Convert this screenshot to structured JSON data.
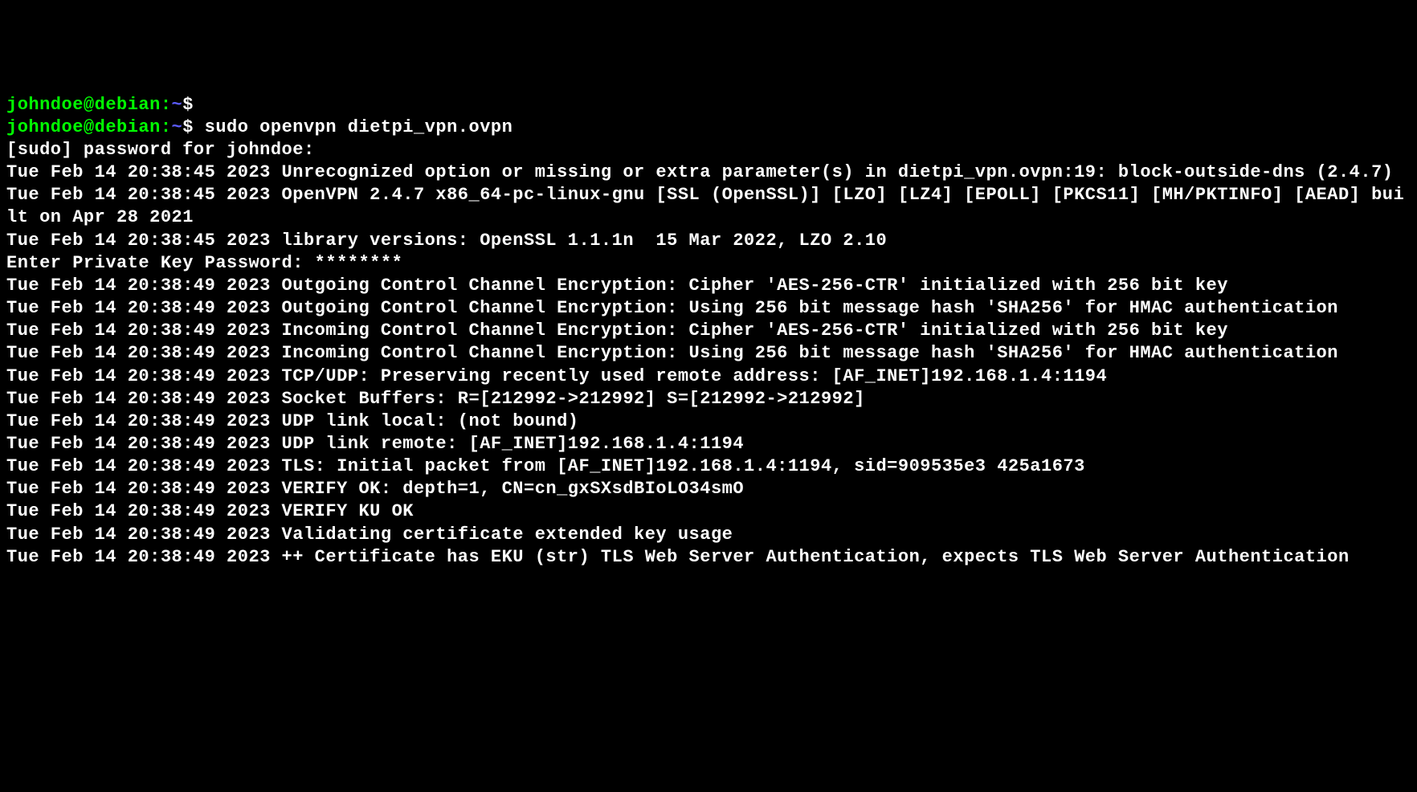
{
  "prompt": {
    "user_host": "johndoe@debian",
    "separator": ":",
    "cwd": "~",
    "symbol": "$"
  },
  "lines": [
    {
      "type": "prompt",
      "cmd": ""
    },
    {
      "type": "prompt",
      "cmd": "sudo openvpn dietpi_vpn.ovpn"
    },
    {
      "type": "output",
      "text": "[sudo] password for johndoe:"
    },
    {
      "type": "output",
      "text": "Tue Feb 14 20:38:45 2023 Unrecognized option or missing or extra parameter(s) in dietpi_vpn.ovpn:19: block-outside-dns (2.4.7)"
    },
    {
      "type": "output",
      "text": "Tue Feb 14 20:38:45 2023 OpenVPN 2.4.7 x86_64-pc-linux-gnu [SSL (OpenSSL)] [LZO] [LZ4] [EPOLL] [PKCS11] [MH/PKTINFO] [AEAD] built on Apr 28 2021"
    },
    {
      "type": "output",
      "text": "Tue Feb 14 20:38:45 2023 library versions: OpenSSL 1.1.1n  15 Mar 2022, LZO 2.10"
    },
    {
      "type": "output",
      "text": "Enter Private Key Password: ********"
    },
    {
      "type": "output",
      "text": "Tue Feb 14 20:38:49 2023 Outgoing Control Channel Encryption: Cipher 'AES-256-CTR' initialized with 256 bit key"
    },
    {
      "type": "output",
      "text": "Tue Feb 14 20:38:49 2023 Outgoing Control Channel Encryption: Using 256 bit message hash 'SHA256' for HMAC authentication"
    },
    {
      "type": "output",
      "text": "Tue Feb 14 20:38:49 2023 Incoming Control Channel Encryption: Cipher 'AES-256-CTR' initialized with 256 bit key"
    },
    {
      "type": "output",
      "text": "Tue Feb 14 20:38:49 2023 Incoming Control Channel Encryption: Using 256 bit message hash 'SHA256' for HMAC authentication"
    },
    {
      "type": "output",
      "text": "Tue Feb 14 20:38:49 2023 TCP/UDP: Preserving recently used remote address: [AF_INET]192.168.1.4:1194"
    },
    {
      "type": "output",
      "text": "Tue Feb 14 20:38:49 2023 Socket Buffers: R=[212992->212992] S=[212992->212992]"
    },
    {
      "type": "output",
      "text": "Tue Feb 14 20:38:49 2023 UDP link local: (not bound)"
    },
    {
      "type": "output",
      "text": "Tue Feb 14 20:38:49 2023 UDP link remote: [AF_INET]192.168.1.4:1194"
    },
    {
      "type": "output",
      "text": "Tue Feb 14 20:38:49 2023 TLS: Initial packet from [AF_INET]192.168.1.4:1194, sid=909535e3 425a1673"
    },
    {
      "type": "output",
      "text": "Tue Feb 14 20:38:49 2023 VERIFY OK: depth=1, CN=cn_gxSXsdBIoLO34smO"
    },
    {
      "type": "output",
      "text": "Tue Feb 14 20:38:49 2023 VERIFY KU OK"
    },
    {
      "type": "output",
      "text": "Tue Feb 14 20:38:49 2023 Validating certificate extended key usage"
    },
    {
      "type": "output",
      "text": "Tue Feb 14 20:38:49 2023 ++ Certificate has EKU (str) TLS Web Server Authentication, expects TLS Web Server Authentication"
    }
  ]
}
